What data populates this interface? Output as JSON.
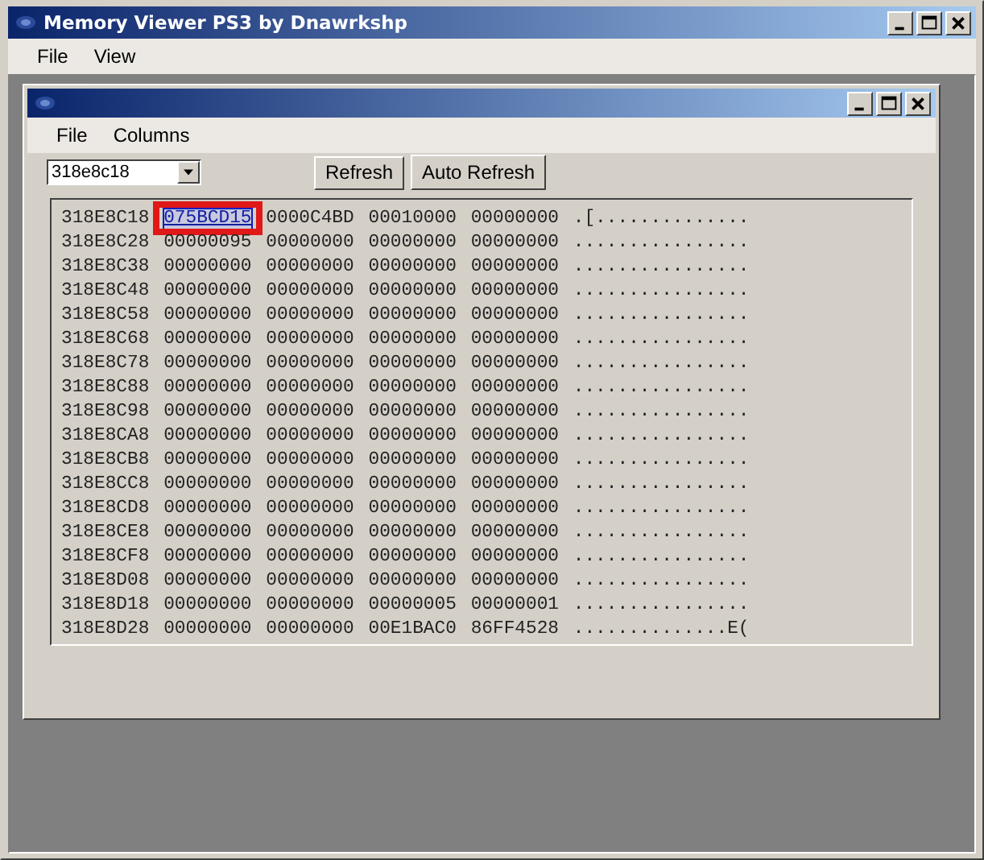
{
  "window": {
    "title": "Memory Viewer PS3 by Dnawrkshp"
  },
  "menu": [
    "File",
    "View"
  ],
  "child_window": {
    "menu": [
      "File",
      "Columns"
    ],
    "address_field": {
      "value": "318e8c18"
    },
    "buttons": [
      "Refresh",
      "Auto Refresh"
    ]
  },
  "hex_view": {
    "rows": [
      {
        "address": "318E8C18",
        "words": [
          {
            "text": "075BCD15",
            "selected": true,
            "highlighted": true
          },
          {
            "text": "0000C4BD",
            "selected": false,
            "highlighted": false
          },
          {
            "text": "00010000",
            "selected": false,
            "highlighted": false
          },
          {
            "text": "00000000",
            "selected": false,
            "highlighted": false
          }
        ],
        "ascii": ".[.............."
      },
      {
        "address": "318E8C28",
        "words": [
          {
            "text": "00000095",
            "selected": false,
            "highlighted": false
          },
          {
            "text": "00000000",
            "selected": false,
            "highlighted": false
          },
          {
            "text": "00000000",
            "selected": false,
            "highlighted": false
          },
          {
            "text": "00000000",
            "selected": false,
            "highlighted": false
          }
        ],
        "ascii": "................"
      },
      {
        "address": "318E8C38",
        "words": [
          {
            "text": "00000000",
            "selected": false,
            "highlighted": false
          },
          {
            "text": "00000000",
            "selected": false,
            "highlighted": false
          },
          {
            "text": "00000000",
            "selected": false,
            "highlighted": false
          },
          {
            "text": "00000000",
            "selected": false,
            "highlighted": false
          }
        ],
        "ascii": "................"
      },
      {
        "address": "318E8C48",
        "words": [
          {
            "text": "00000000",
            "selected": false,
            "highlighted": false
          },
          {
            "text": "00000000",
            "selected": false,
            "highlighted": false
          },
          {
            "text": "00000000",
            "selected": false,
            "highlighted": false
          },
          {
            "text": "00000000",
            "selected": false,
            "highlighted": false
          }
        ],
        "ascii": "................"
      },
      {
        "address": "318E8C58",
        "words": [
          {
            "text": "00000000",
            "selected": false,
            "highlighted": false
          },
          {
            "text": "00000000",
            "selected": false,
            "highlighted": false
          },
          {
            "text": "00000000",
            "selected": false,
            "highlighted": false
          },
          {
            "text": "00000000",
            "selected": false,
            "highlighted": false
          }
        ],
        "ascii": "................"
      },
      {
        "address": "318E8C68",
        "words": [
          {
            "text": "00000000",
            "selected": false,
            "highlighted": false
          },
          {
            "text": "00000000",
            "selected": false,
            "highlighted": false
          },
          {
            "text": "00000000",
            "selected": false,
            "highlighted": false
          },
          {
            "text": "00000000",
            "selected": false,
            "highlighted": false
          }
        ],
        "ascii": "................"
      },
      {
        "address": "318E8C78",
        "words": [
          {
            "text": "00000000",
            "selected": false,
            "highlighted": false
          },
          {
            "text": "00000000",
            "selected": false,
            "highlighted": false
          },
          {
            "text": "00000000",
            "selected": false,
            "highlighted": false
          },
          {
            "text": "00000000",
            "selected": false,
            "highlighted": false
          }
        ],
        "ascii": "................"
      },
      {
        "address": "318E8C88",
        "words": [
          {
            "text": "00000000",
            "selected": false,
            "highlighted": false
          },
          {
            "text": "00000000",
            "selected": false,
            "highlighted": false
          },
          {
            "text": "00000000",
            "selected": false,
            "highlighted": false
          },
          {
            "text": "00000000",
            "selected": false,
            "highlighted": false
          }
        ],
        "ascii": "................"
      },
      {
        "address": "318E8C98",
        "words": [
          {
            "text": "00000000",
            "selected": false,
            "highlighted": false
          },
          {
            "text": "00000000",
            "selected": false,
            "highlighted": false
          },
          {
            "text": "00000000",
            "selected": false,
            "highlighted": false
          },
          {
            "text": "00000000",
            "selected": false,
            "highlighted": false
          }
        ],
        "ascii": "................"
      },
      {
        "address": "318E8CA8",
        "words": [
          {
            "text": "00000000",
            "selected": false,
            "highlighted": false
          },
          {
            "text": "00000000",
            "selected": false,
            "highlighted": false
          },
          {
            "text": "00000000",
            "selected": false,
            "highlighted": false
          },
          {
            "text": "00000000",
            "selected": false,
            "highlighted": false
          }
        ],
        "ascii": "................"
      },
      {
        "address": "318E8CB8",
        "words": [
          {
            "text": "00000000",
            "selected": false,
            "highlighted": false
          },
          {
            "text": "00000000",
            "selected": false,
            "highlighted": false
          },
          {
            "text": "00000000",
            "selected": false,
            "highlighted": false
          },
          {
            "text": "00000000",
            "selected": false,
            "highlighted": false
          }
        ],
        "ascii": "................"
      },
      {
        "address": "318E8CC8",
        "words": [
          {
            "text": "00000000",
            "selected": false,
            "highlighted": false
          },
          {
            "text": "00000000",
            "selected": false,
            "highlighted": false
          },
          {
            "text": "00000000",
            "selected": false,
            "highlighted": false
          },
          {
            "text": "00000000",
            "selected": false,
            "highlighted": false
          }
        ],
        "ascii": "................"
      },
      {
        "address": "318E8CD8",
        "words": [
          {
            "text": "00000000",
            "selected": false,
            "highlighted": false
          },
          {
            "text": "00000000",
            "selected": false,
            "highlighted": false
          },
          {
            "text": "00000000",
            "selected": false,
            "highlighted": false
          },
          {
            "text": "00000000",
            "selected": false,
            "highlighted": false
          }
        ],
        "ascii": "................"
      },
      {
        "address": "318E8CE8",
        "words": [
          {
            "text": "00000000",
            "selected": false,
            "highlighted": false
          },
          {
            "text": "00000000",
            "selected": false,
            "highlighted": false
          },
          {
            "text": "00000000",
            "selected": false,
            "highlighted": false
          },
          {
            "text": "00000000",
            "selected": false,
            "highlighted": false
          }
        ],
        "ascii": "................"
      },
      {
        "address": "318E8CF8",
        "words": [
          {
            "text": "00000000",
            "selected": false,
            "highlighted": false
          },
          {
            "text": "00000000",
            "selected": false,
            "highlighted": false
          },
          {
            "text": "00000000",
            "selected": false,
            "highlighted": false
          },
          {
            "text": "00000000",
            "selected": false,
            "highlighted": false
          }
        ],
        "ascii": "................"
      },
      {
        "address": "318E8D08",
        "words": [
          {
            "text": "00000000",
            "selected": false,
            "highlighted": false
          },
          {
            "text": "00000000",
            "selected": false,
            "highlighted": false
          },
          {
            "text": "00000000",
            "selected": false,
            "highlighted": false
          },
          {
            "text": "00000000",
            "selected": false,
            "highlighted": false
          }
        ],
        "ascii": "................"
      },
      {
        "address": "318E8D18",
        "words": [
          {
            "text": "00000000",
            "selected": false,
            "highlighted": false
          },
          {
            "text": "00000000",
            "selected": false,
            "highlighted": false
          },
          {
            "text": "00000005",
            "selected": false,
            "highlighted": false
          },
          {
            "text": "00000001",
            "selected": false,
            "highlighted": false
          }
        ],
        "ascii": "................"
      },
      {
        "address": "318E8D28",
        "words": [
          {
            "text": "00000000",
            "selected": false,
            "highlighted": false
          },
          {
            "text": "00000000",
            "selected": false,
            "highlighted": false
          },
          {
            "text": "00E1BAC0",
            "selected": false,
            "highlighted": false
          },
          {
            "text": "86FF4528",
            "selected": false,
            "highlighted": false
          }
        ],
        "ascii": "..............E("
      }
    ]
  }
}
